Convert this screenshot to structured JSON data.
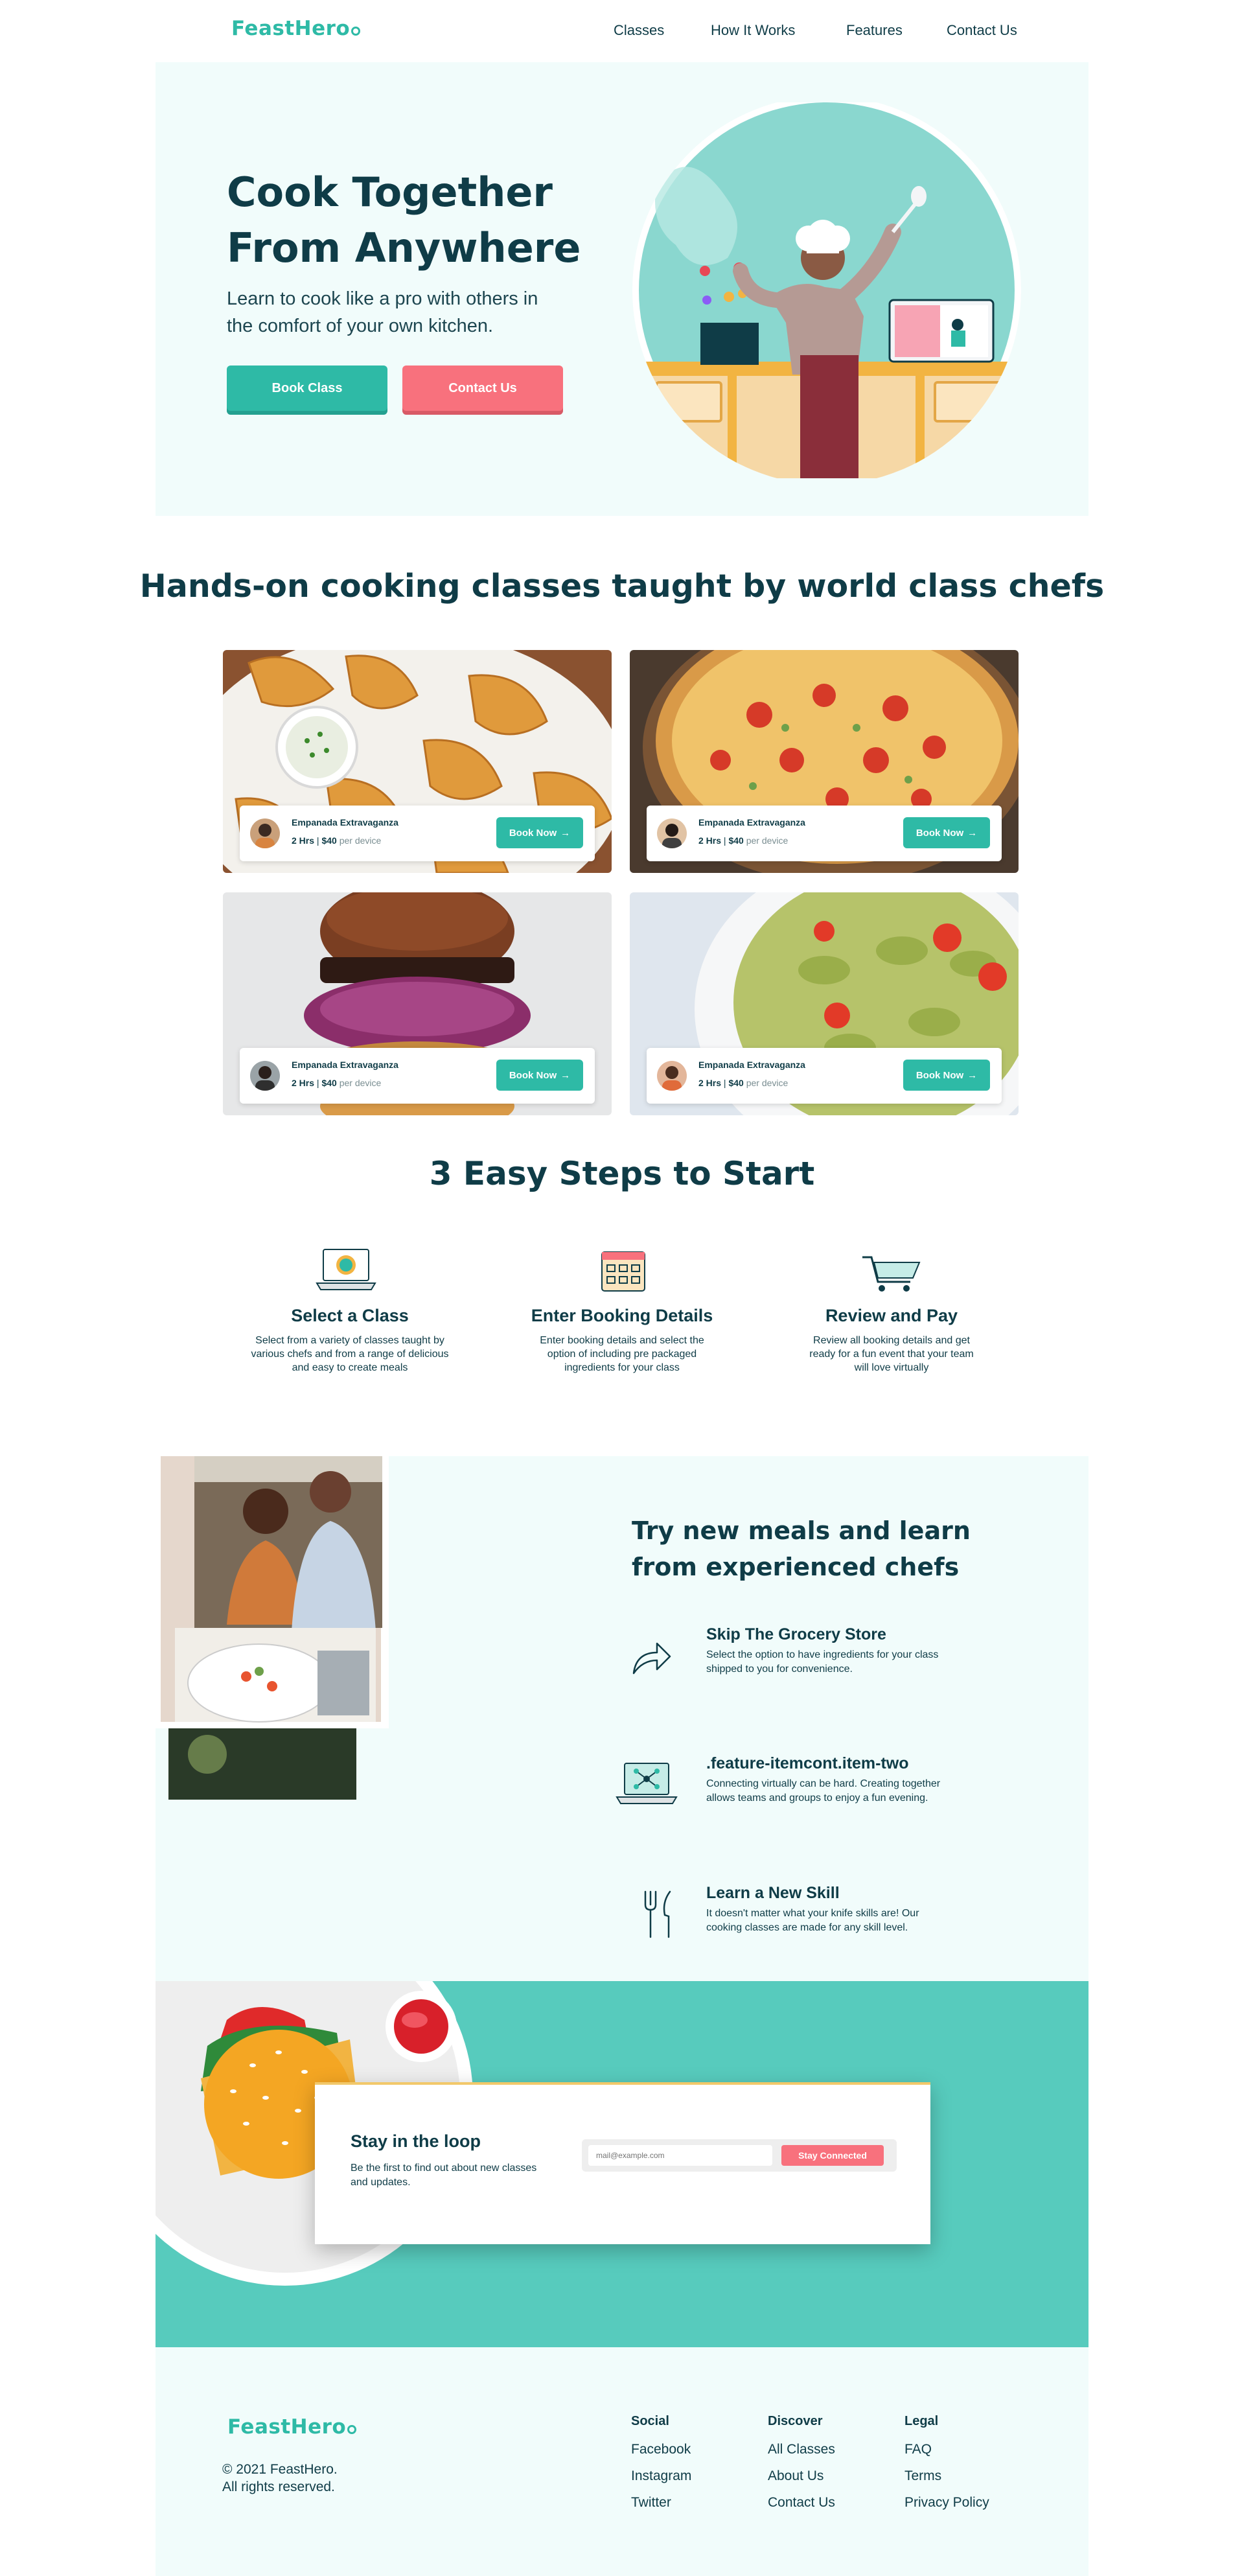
{
  "brand": {
    "name": "FeastHero",
    "accent": "#2ebaa6",
    "pink": "#f8717d",
    "dark": "#0f3c47"
  },
  "nav": {
    "items": [
      "Classes",
      "How It Works",
      "Features",
      "Contact Us"
    ]
  },
  "hero": {
    "title_line1": "Cook Together",
    "title_line2": "From Anywhere",
    "subtitle_line1": "Learn to cook like a pro with others in",
    "subtitle_line2": "the comfort of your own kitchen.",
    "book_label": "Book Class",
    "contact_label": "Contact Us"
  },
  "classes": {
    "title": "Hands-on cooking classes taught by world class chefs",
    "cards": [
      {
        "name": "Empanada Extravaganza",
        "hours": "2 Hrs",
        "price": "$40",
        "per": "per device",
        "button": "Book Now",
        "image": "empanadas"
      },
      {
        "name": "Empanada Extravaganza",
        "hours": "2 Hrs",
        "price": "$40",
        "per": "per device",
        "button": "Book Now",
        "image": "pizza"
      },
      {
        "name": "Empanada Extravaganza",
        "hours": "2 Hrs",
        "price": "$40",
        "per": "per device",
        "button": "Book Now",
        "image": "burger"
      },
      {
        "name": "Empanada Extravaganza",
        "hours": "2 Hrs",
        "price": "$40",
        "per": "per device",
        "button": "Book Now",
        "image": "pasta"
      }
    ]
  },
  "steps": {
    "title": "3 Easy Steps to Start",
    "items": [
      {
        "icon": "laptop-icon",
        "title": "Select a Class",
        "line1": "Select from a variety of classes taught by",
        "line2": "various chefs and from a range of delicious",
        "line3": "and easy to create meals"
      },
      {
        "icon": "calendar-icon",
        "title": "Enter Booking Details",
        "line1": "Enter booking details and select the",
        "line2": "option of including pre packaged",
        "line3": "ingredients for your class"
      },
      {
        "icon": "cart-icon",
        "title": "Review and Pay",
        "line1": "Review all booking details and get",
        "line2": "ready for a fun event that your team",
        "line3": "will love virtually"
      }
    ]
  },
  "features": {
    "title_line1": "Try new meals and learn",
    "title_line2": "from experienced chefs",
    "items": [
      {
        "icon": "share-arrow-icon",
        "title": "Skip The Grocery Store",
        "line1": "Select the option to have ingredients for your class",
        "line2": "shipped to you for convenience."
      },
      {
        "icon": "network-laptop-icon",
        "title": ".feature-itemcont.item-two",
        "line1": "Connecting virtually can be hard. Creating together",
        "line2": "allows teams and groups to enjoy a fun evening."
      },
      {
        "icon": "fork-knife-icon",
        "title": "Learn a New Skill",
        "line1": "It doesn't matter what your knife skills are! Our",
        "line2": "cooking classes are made for any skill level."
      }
    ]
  },
  "newsletter": {
    "title": "Stay in the loop",
    "line1": "Be the first to find out about new classes",
    "line2": "and updates.",
    "placeholder": "mail@example.com",
    "button": "Stay Connected"
  },
  "footer": {
    "copyright_line1": "© 2021 FeastHero.",
    "copyright_line2": "All rights reserved.",
    "columns": [
      {
        "title": "Social",
        "links": [
          "Facebook",
          "Instagram",
          "Twitter"
        ]
      },
      {
        "title": "Discover",
        "links": [
          "All Classes",
          "About Us",
          "Contact Us"
        ]
      },
      {
        "title": "Legal",
        "links": [
          "FAQ",
          "Terms",
          "Privacy Policy"
        ]
      }
    ]
  }
}
